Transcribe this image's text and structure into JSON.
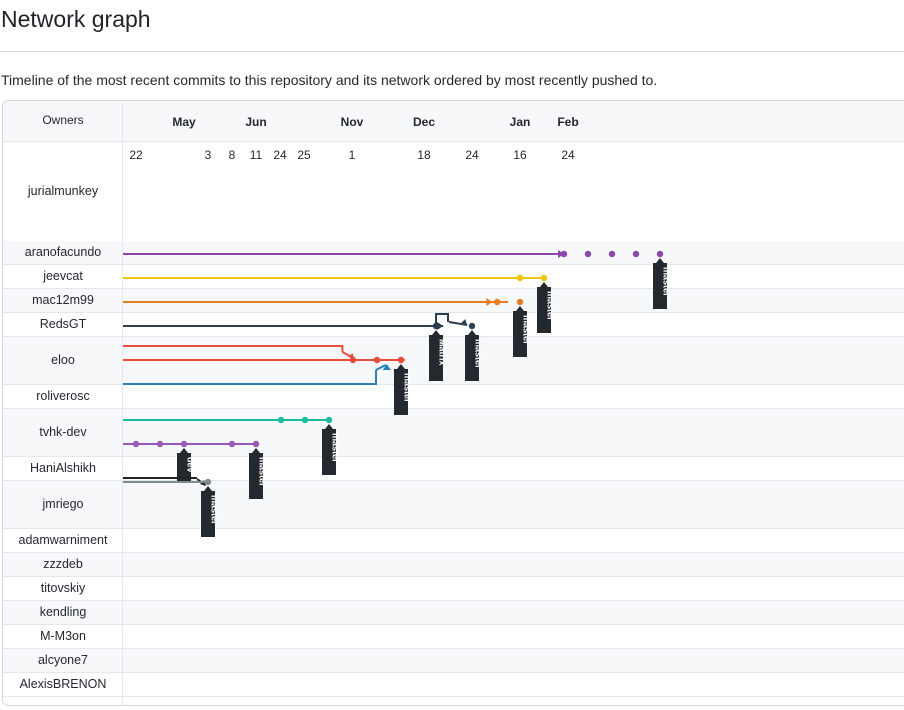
{
  "page": {
    "title": "Network graph",
    "description": "Timeline of the most recent commits to this repository and its network ordered by most recently pushed to."
  },
  "graph": {
    "owners_header": "Owners",
    "months": [
      {
        "label": "May",
        "day_index": 2
      },
      {
        "label": "Jun",
        "day_index": 5
      },
      {
        "label": "Nov",
        "day_index": 9
      },
      {
        "label": "Dec",
        "day_index": 12
      },
      {
        "label": "Jan",
        "day_index": 16
      },
      {
        "label": "Feb",
        "day_index": 18
      }
    ],
    "days": [
      "22",
      "",
      "",
      "3",
      "8",
      "11",
      "24",
      "25",
      "",
      "1",
      "",
      "",
      "18",
      "",
      "24",
      "",
      "16",
      "",
      "24"
    ],
    "owners": [
      {
        "name": "jurialmunkey",
        "rows": 4
      },
      {
        "name": "aranofacundo",
        "rows": 1
      },
      {
        "name": "jeevcat",
        "rows": 1
      },
      {
        "name": "mac12m99",
        "rows": 1
      },
      {
        "name": "RedsGT",
        "rows": 1
      },
      {
        "name": "eloo",
        "rows": 2
      },
      {
        "name": "roliverosc",
        "rows": 1
      },
      {
        "name": "tvhk-dev",
        "rows": 2
      },
      {
        "name": "HaniAlshikh",
        "rows": 1
      },
      {
        "name": "jmriego",
        "rows": 2
      },
      {
        "name": "adamwarniment",
        "rows": 1
      },
      {
        "name": "zzzdeb",
        "rows": 1
      },
      {
        "name": "titovskiy",
        "rows": 1
      },
      {
        "name": "kendling",
        "rows": 1
      },
      {
        "name": "M-M3on",
        "rows": 1
      },
      {
        "name": "alcyone7",
        "rows": 1
      },
      {
        "name": "AlexisBRENON",
        "rows": 1
      }
    ],
    "colors": {
      "aranofacundo": "#8e44ad",
      "jeevcat": "#f1c40f",
      "mac12m99": "#e67e22",
      "RedsGT": "#2c3e50",
      "eloo_red": "#e74c3c",
      "eloo_blue": "#2980b9",
      "roliverosc": "#1abc9c",
      "tvhk_purple": "#9b59b6",
      "tvhk_black": "#222222",
      "HaniAlshikh": "#7f8c8d",
      "tag_bg": "#24292f"
    },
    "branches": [
      {
        "color": "aranofacundo",
        "line": {
          "lane": 4,
          "from": -1,
          "to": 18.8,
          "arrow": true
        },
        "commits": [
          {
            "lane": 4,
            "day": 18
          },
          {
            "lane": 4,
            "day": 19
          },
          {
            "lane": 4,
            "day": 20
          },
          {
            "lane": 4,
            "day": 21
          },
          {
            "lane": 4,
            "day": 22
          }
        ],
        "tags": [
          {
            "label": "master",
            "lane": 4,
            "day": 22
          }
        ]
      },
      {
        "color": "jeevcat",
        "line": {
          "lane": 5,
          "from": -1,
          "to": 17
        },
        "commits": [
          {
            "lane": 5,
            "day": 16
          },
          {
            "lane": 5,
            "day": 17
          }
        ],
        "tags": [
          {
            "label": "master",
            "lane": 5,
            "day": 17
          }
        ]
      },
      {
        "color": "mac12m99",
        "line": {
          "lane": 6,
          "from": -1,
          "to": 15
        },
        "commits": [
          {
            "lane": 6,
            "day": 14.9,
            "arrowOnly": true
          },
          {
            "lane": 6,
            "day": 15
          },
          {
            "lane": 6,
            "day": 16
          }
        ],
        "tags": [
          {
            "label": "master",
            "lane": 6,
            "day": 16
          }
        ]
      },
      {
        "color": "RedsGT",
        "line": {
          "lane": 7,
          "from": -1,
          "to": 13
        },
        "commits": [
          {
            "lane": 7,
            "day": 13
          },
          {
            "lane": 7,
            "day": 14
          }
        ],
        "tags": [
          {
            "label": "Matrix",
            "lane": 7,
            "day": 13
          },
          {
            "label": "master",
            "lane": 7,
            "day": 14
          }
        ]
      },
      {
        "color": "eloo_red",
        "commits": [
          {
            "lane": 9,
            "day": 9.5
          },
          {
            "lane": 9,
            "day": 10.5
          },
          {
            "lane": 9,
            "day": 11.5
          }
        ],
        "tags": [
          {
            "label": "master",
            "lane": 9,
            "day": 11.5
          }
        ]
      },
      {
        "color": "roliverosc",
        "commits": [
          {
            "lane": 11,
            "day": 6.5
          },
          {
            "lane": 11,
            "day": 7.5
          },
          {
            "lane": 11,
            "day": 8.5
          }
        ],
        "tags": [
          {
            "label": "master",
            "lane": 11,
            "day": 8.5
          }
        ]
      },
      {
        "color": "tvhk_purple",
        "commits": [
          {
            "lane": 12,
            "day": 0
          },
          {
            "lane": 12,
            "day": 1
          },
          {
            "lane": 12,
            "day": 2
          },
          {
            "lane": 12,
            "day": 4
          },
          {
            "lane": 12,
            "day": 5
          }
        ],
        "tags": [
          {
            "label": "dev",
            "lane": 12,
            "day": 2
          },
          {
            "label": "master",
            "lane": 12,
            "day": 5
          }
        ]
      },
      {
        "color": "HaniAlshikh",
        "commits": [
          {
            "lane": 14,
            "day": 3
          }
        ],
        "tags": [
          {
            "label": "master",
            "lane": 14,
            "day": 3
          }
        ]
      }
    ]
  }
}
